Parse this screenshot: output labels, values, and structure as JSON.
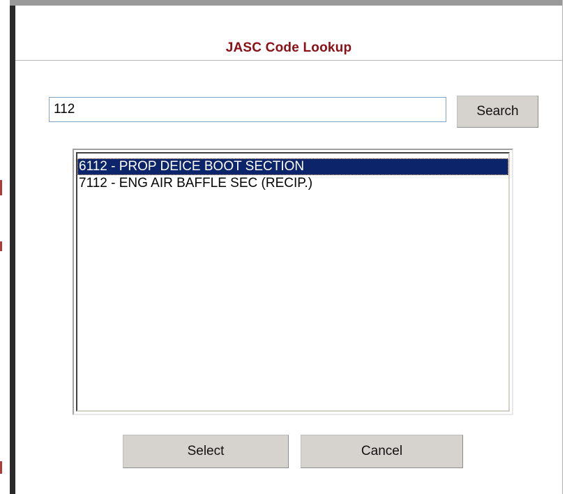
{
  "dialog": {
    "title": "JASC Code Lookup"
  },
  "search": {
    "value": "112",
    "button_label": "Search"
  },
  "results": {
    "items": [
      {
        "label": "6112 - PROP DEICE BOOT SECTION",
        "selected": true
      },
      {
        "label": "7112 - ENG AIR BAFFLE SEC (RECIP.)",
        "selected": false
      }
    ]
  },
  "actions": {
    "select_label": "Select",
    "cancel_label": "Cancel"
  },
  "colors": {
    "title": "#8b0f17",
    "selection": "#0b246a",
    "button_face": "#d6d3ce"
  }
}
